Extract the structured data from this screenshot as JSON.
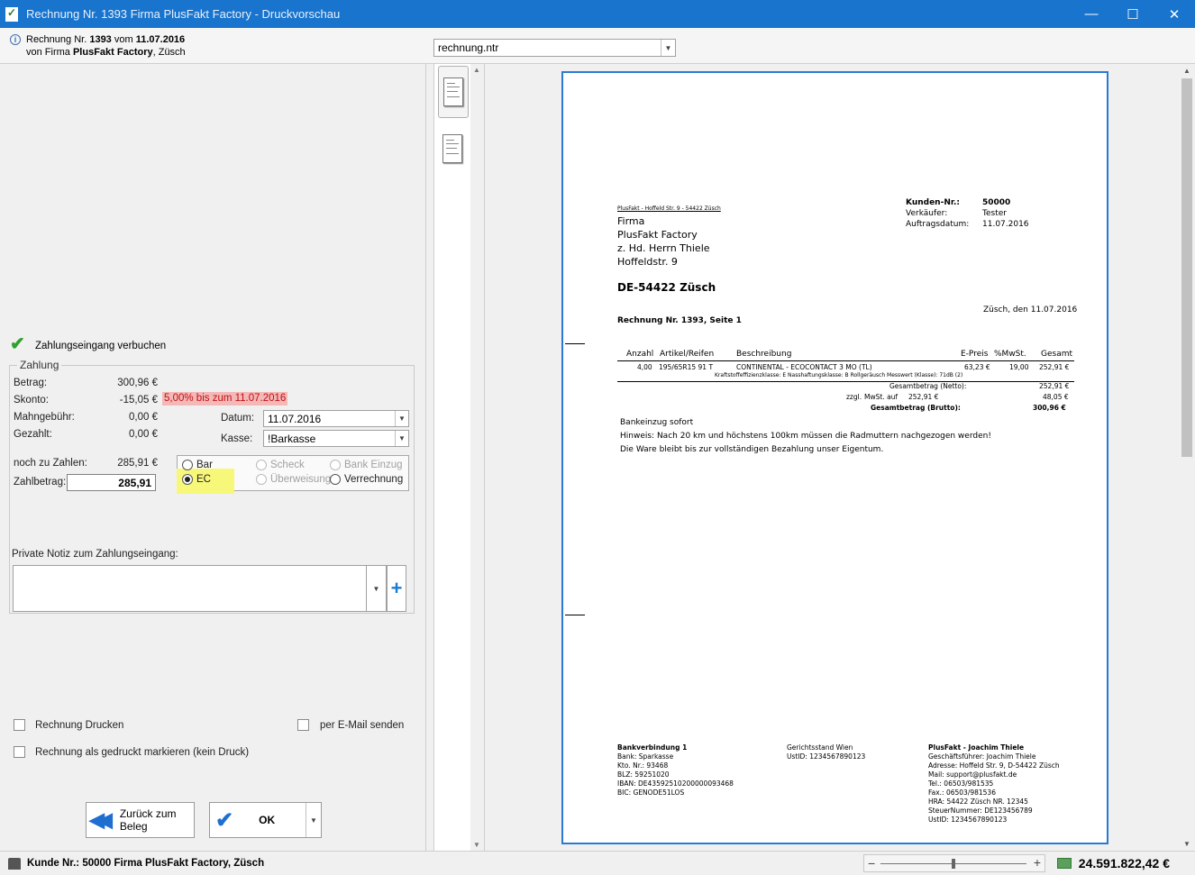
{
  "window": {
    "title": "Rechnung Nr. 1393 Firma PlusFakt Factory - Druckvorschau",
    "minimize": "—",
    "maximize": "☐",
    "close": "✕"
  },
  "header": {
    "line1_prefix": "Rechnung Nr.",
    "invoice_no": "1393",
    "line1_mid": "vom",
    "invoice_date": "11.07.2016",
    "line2_prefix": "von Firma",
    "company": "PlusFakt Factory",
    "city": ", Züsch",
    "layout_file": "rechnung.ntr"
  },
  "payment": {
    "book_label": "Zahlungseingang verbuchen",
    "group_title": "Zahlung",
    "betrag_label": "Betrag:",
    "betrag_value": "300,96 €",
    "skonto_label": "Skonto:",
    "skonto_value": "-15,05 €",
    "skonto_info": "5,00% bis zum 11.07.2016",
    "mahngebuehr_label": "Mahngebühr:",
    "mahngebuehr_value": "0,00 €",
    "gezahlt_label": "Gezahlt:",
    "gezahlt_value": "0,00 €",
    "datum_label": "Datum:",
    "datum_value": "11.07.2016",
    "kasse_label": "Kasse:",
    "kasse_value": "!Barkasse",
    "noch_label": "noch zu Zahlen:",
    "noch_value": "285,91 €",
    "zahlbetrag_label": "Zahlbetrag:",
    "zahlbetrag_value": "285,91",
    "methods": {
      "bar": "Bar",
      "ec": "EC",
      "scheck": "Scheck",
      "ueberweisung": "Überweisung",
      "bankeinzug": "Bank Einzug",
      "verrechnung": "Verrechnung"
    },
    "selected_method": "EC",
    "note_label": "Private Notiz zum Zahlungseingang:",
    "note_value": ""
  },
  "options": {
    "print_label": "Rechnung Drucken",
    "email_label": "per E-Mail senden",
    "mark_printed_label": "Rechnung als gedruckt markieren (kein Druck)"
  },
  "buttons": {
    "back_label": "Zurück zum Beleg",
    "ok_label": "OK"
  },
  "document": {
    "sender_line": "PlusFakt - Hoffeld Str. 9 - 54422 Züsch",
    "recipient": [
      "Firma",
      "PlusFakt Factory",
      "z. Hd. Herrn Thiele",
      "Hoffeldstr. 9"
    ],
    "recipient_city": "DE-54422 Züsch",
    "meta": [
      {
        "label": "Kunden-Nr.:",
        "value": "50000"
      },
      {
        "label": "Verkäufer:",
        "value": "Tester"
      },
      {
        "label": "Auftragsdatum:",
        "value": "11.07.2016"
      }
    ],
    "place_date": "Züsch, den 11.07.2016",
    "heading": "Rechnung Nr. 1393, Seite 1",
    "columns": {
      "anzahl": "Anzahl",
      "artikel": "Artikel/Reifen",
      "beschreibung": "Beschreibung",
      "epreis": "E-Preis",
      "mwst": "%MwSt.",
      "gesamt": "Gesamt"
    },
    "row": {
      "anzahl": "4,00",
      "artikel": "195/65R15 91 T",
      "beschreibung": "CONTINENTAL - ECOCONTACT 3 MO (TL)",
      "epreis": "63,23 €",
      "mwst": "19,00",
      "gesamt": "252,91 €",
      "detail": "Kraftstoffeffizienzklasse: E    Nasshaftungsklasse: B    Rollgeräusch Messwert (Klasse): 71dB (2)"
    },
    "totals": {
      "netto_label": "Gesamtbetrag (Netto):",
      "netto_value": "252,91 €",
      "mwst_prefix": "zzgl.",
      "mwst_label": "MwSt. auf",
      "mwst_base": "252,91 €",
      "mwst_value": "48,05 €",
      "brutto_label": "Gesamtbetrag (Brutto):",
      "brutto_value": "300,96 €"
    },
    "notes": [
      "Bankeinzug sofort",
      "Hinweis: Nach 20 km und höchstens 100km müssen die Radmuttern nachgezogen werden!",
      "Die Ware bleibt bis zur vollständigen Bezahlung unser Eigentum."
    ],
    "footer_bank": {
      "title": "Bankverbindung 1",
      "lines": [
        "Bank: Sparkasse",
        "Kto. Nr.: 93468",
        "BLZ: 59251020",
        "IBAN: DE43592510200000093468",
        "BIC: GENODE51LOS"
      ]
    },
    "footer_court": {
      "lines": [
        "Gerichtsstand Wien",
        "UstID: 1234567890123"
      ]
    },
    "footer_company": {
      "title": "PlusFakt - Joachim Thiele",
      "lines": [
        "Geschäftsführer: Joachim Thiele",
        "Adresse: Hoffeld Str. 9, D-54422 Züsch",
        "Mail: support@plusfakt.de",
        "Tel.: 06503/981535",
        "Fax.: 06503/981536",
        "HRA: 54422 Züsch NR. 12345",
        "SteuerNummer: DE123456789",
        "UstID: 1234567890123"
      ]
    }
  },
  "status": {
    "customer": "Kunde  Nr.: 50000 Firma  PlusFakt Factory, Züsch",
    "zoom_level": 0.5,
    "total": "24.591.822,42 €"
  },
  "colors": {
    "titlebar": "#1874cd",
    "accent": "#1f6fd0",
    "skonto_highlight": "#f4b8b8",
    "selection_highlight": "#f7f77a",
    "page_border": "#2a7ad4"
  },
  "icons": [
    "app-icon",
    "info-icon",
    "checkmark-icon",
    "double-arrow-left-icon",
    "checkmark-ok-icon",
    "plus-icon",
    "chevron-down-icon",
    "customer-icon",
    "money-icon"
  ]
}
